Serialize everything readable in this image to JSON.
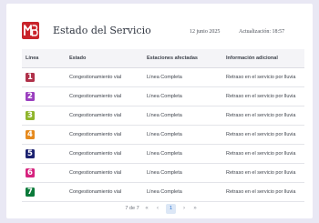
{
  "header": {
    "logo_label": "MB",
    "title": "Estado del Servicio",
    "date": "12 junio 2025",
    "updated": "Actualización: 18:57"
  },
  "table": {
    "columns": [
      "Línea",
      "Estado",
      "Estaciones afectadas",
      "Información adicional"
    ],
    "rows": [
      {
        "line": "1",
        "color": "#b0314a",
        "status": "Congestionamiento vial",
        "stations": "Línea Completa",
        "info": "Retraso en el servicio por lluvia"
      },
      {
        "line": "2",
        "color": "#9b3fbf",
        "status": "Congestionamiento vial",
        "stations": "Línea Completa",
        "info": "Retraso en el servicio por lluvia"
      },
      {
        "line": "3",
        "color": "#8fb52c",
        "status": "Congestionamiento vial",
        "stations": "Línea Completa",
        "info": "Retraso en el servicio por lluvia"
      },
      {
        "line": "4",
        "color": "#e68a1e",
        "status": "Congestionamiento vial",
        "stations": "Línea Completa",
        "info": "Retraso en el servicio por lluvia"
      },
      {
        "line": "5",
        "color": "#1c2270",
        "status": "Congestionamiento vial",
        "stations": "Línea Completa",
        "info": "Retraso en el servicio por lluvia"
      },
      {
        "line": "6",
        "color": "#d6237e",
        "status": "Congestionamiento vial",
        "stations": "Línea Completa",
        "info": "Retraso en el servicio por lluvia"
      },
      {
        "line": "7",
        "color": "#0b7a3a",
        "status": "Congestionamiento vial",
        "stations": "Línea Completa",
        "info": "Retraso en el servicio por lluvia"
      }
    ]
  },
  "pagination": {
    "total": "7 de 7",
    "first": "«",
    "prev": "‹",
    "current": "1",
    "next": "›",
    "last": "»"
  },
  "colors": {
    "background": "#e9e8f4",
    "logo": "#c9242b",
    "page_active": "#1f6fd1"
  }
}
